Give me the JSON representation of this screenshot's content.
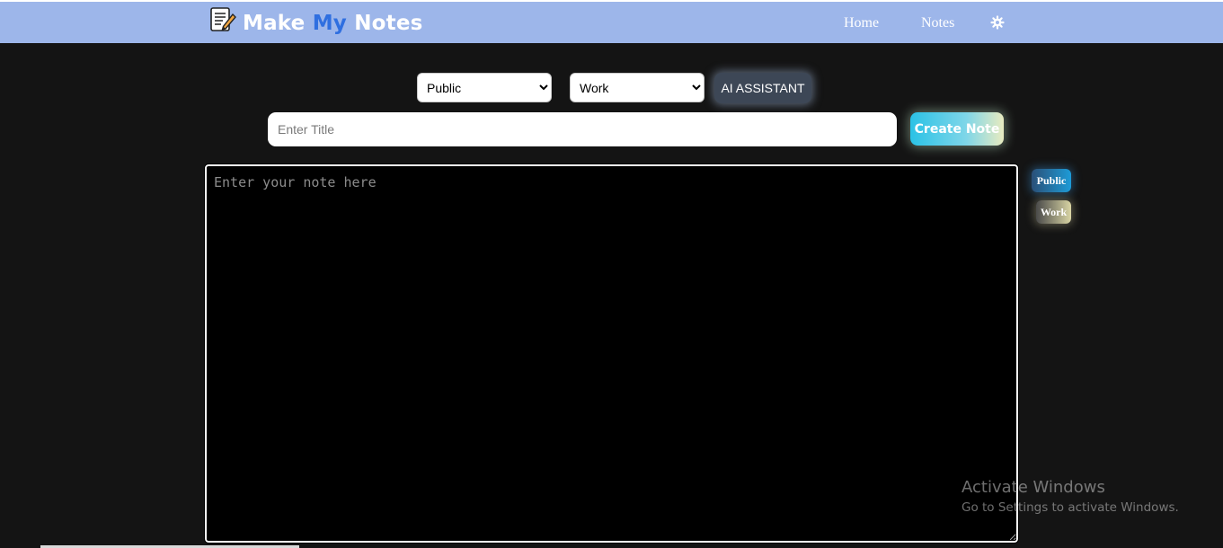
{
  "header": {
    "brand": {
      "part1": "Make",
      "part2": "My",
      "part3": "Notes"
    },
    "nav": {
      "home": "Home",
      "notes": "Notes"
    },
    "icons": {
      "logo": "notepad-pencil-icon",
      "settings": "gear-icon"
    },
    "colors": {
      "navbar": "#9db6ea",
      "brand_accent": "#2f6fe0"
    }
  },
  "toolbar": {
    "visibility_select": {
      "selected": "Public"
    },
    "category_select": {
      "selected": "Work"
    },
    "ai_button": "AI ASSISTANT"
  },
  "form": {
    "title_placeholder": "Enter Title",
    "title_value": "",
    "create_button": "Create Note",
    "note_placeholder": "Enter your note here",
    "note_value": ""
  },
  "tags": {
    "public": "Public",
    "work": "Work"
  },
  "watermark": {
    "title": "Activate Windows",
    "subtitle": "Go to Settings to activate Windows."
  }
}
